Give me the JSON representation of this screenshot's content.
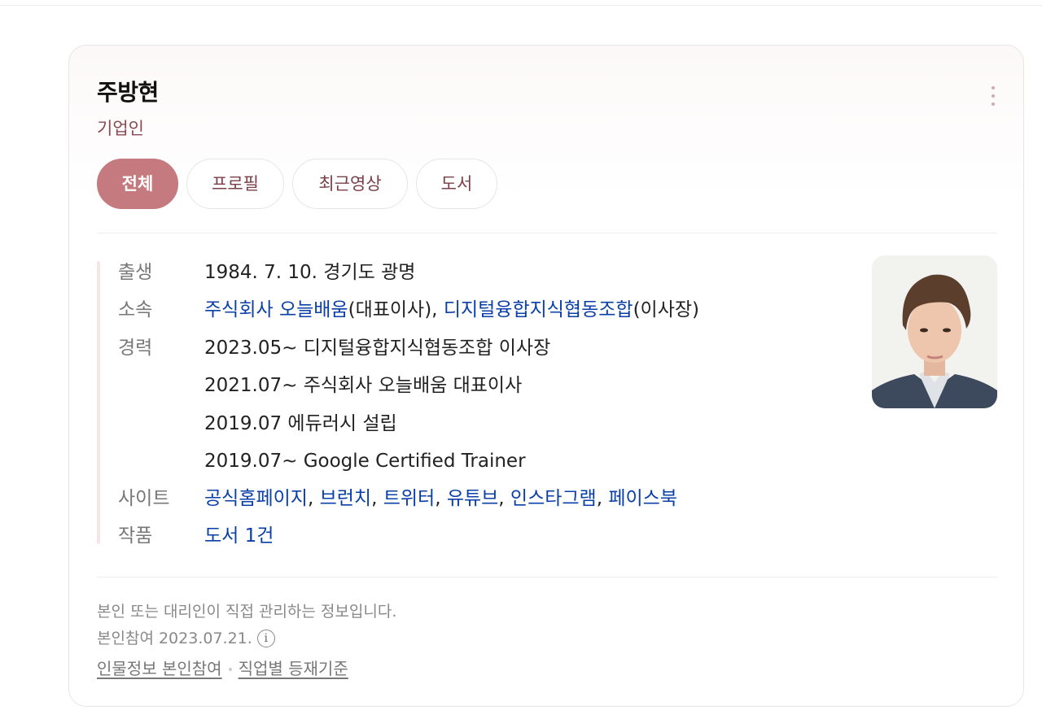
{
  "profile": {
    "name": "주방현",
    "occupation": "기업인"
  },
  "tabs": [
    {
      "label": "전체",
      "active": true
    },
    {
      "label": "프로필",
      "active": false
    },
    {
      "label": "최근영상",
      "active": false
    },
    {
      "label": "도서",
      "active": false
    }
  ],
  "info": {
    "birth": {
      "label": "출생",
      "value": "1984. 7. 10. 경기도 광명"
    },
    "affiliation": {
      "label": "소속",
      "org1": "주식회사 오늘배움",
      "org1_role": "(대표이사), ",
      "org2": "디지털융합지식협동조합",
      "org2_role": "(이사장)"
    },
    "career": {
      "label": "경력",
      "items": [
        "2023.05~ 디지털융합지식협동조합 이사장",
        "2021.07~ 주식회사 오늘배움 대표이사",
        "2019.07 에듀러시 설립",
        "2019.07~ Google Certified Trainer"
      ]
    },
    "sites": {
      "label": "사이트",
      "links": [
        "공식홈페이지",
        "브런치",
        "트위터",
        "유튜브",
        "인스타그램",
        "페이스북"
      ],
      "separator": ", "
    },
    "works": {
      "label": "작품",
      "value": "도서 1건"
    }
  },
  "footer": {
    "managed_note": "본인 또는 대리인이 직접 관리하는 정보입니다.",
    "participation": "본인참여 2023.07.21.",
    "info_icon_glyph": "i",
    "link1": "인물정보 본인참여",
    "link2": "직업별 등재기준"
  },
  "colors": {
    "accent": "#c47a7e",
    "link": "#0a3fa8",
    "subtitle": "#8a4a52"
  }
}
